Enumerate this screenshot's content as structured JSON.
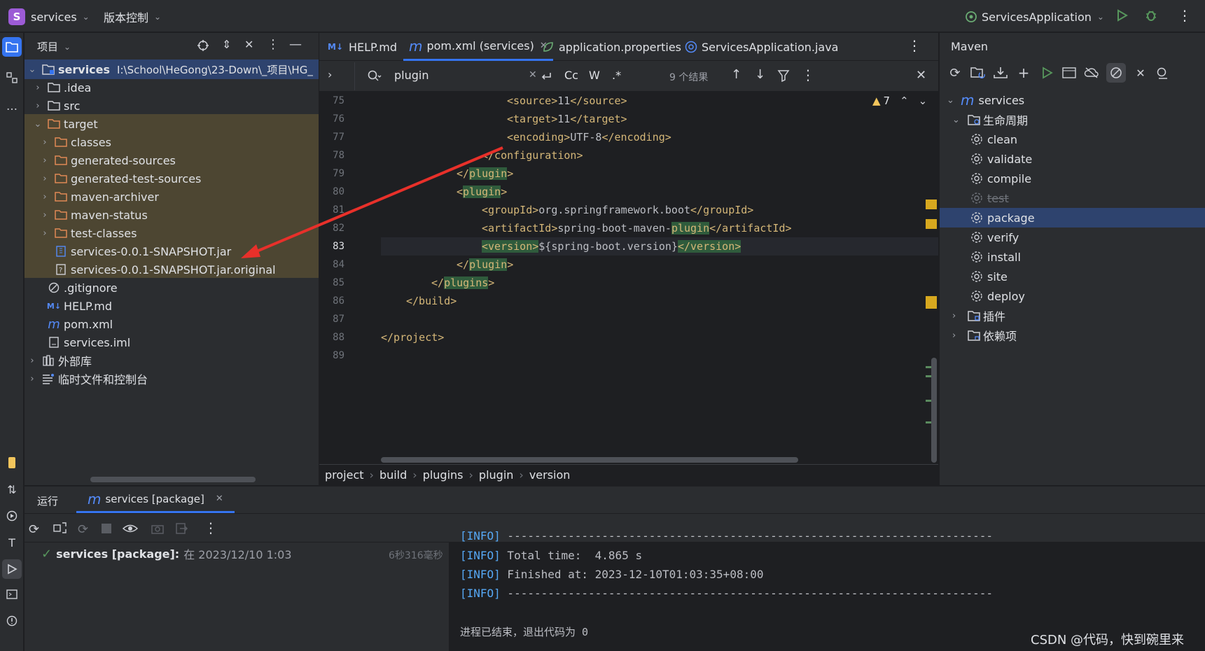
{
  "titlebar": {
    "project_badge": "S",
    "project_name": "services",
    "vcs": "版本控制",
    "run_config": "ServicesApplication"
  },
  "project_panel": {
    "title": "项目",
    "root": {
      "name": "services",
      "path": "I:\\School\\HeGong\\23-Down\\_项目\\HG_"
    },
    "items": [
      ".idea",
      "src",
      "target",
      "classes",
      "generated-sources",
      "generated-test-sources",
      "maven-archiver",
      "maven-status",
      "test-classes",
      "services-0.0.1-SNAPSHOT.jar",
      "services-0.0.1-SNAPSHOT.jar.original",
      ".gitignore",
      "HELP.md",
      "pom.xml",
      "services.iml",
      "外部库",
      "临时文件和控制台"
    ]
  },
  "editor": {
    "tabs": [
      "HELP.md",
      "pom.xml (services)",
      "application.properties",
      "ServicesApplication.java"
    ],
    "find": {
      "query": "plugin",
      "results": "9 个结果",
      "opt_cc": "Cc",
      "opt_w": "W",
      "opt_regex": ".*"
    },
    "warnings": "7",
    "line_numbers": [
      "75",
      "76",
      "77",
      "78",
      "79",
      "80",
      "81",
      "82",
      "83",
      "84",
      "85",
      "86",
      "87",
      "88",
      "89"
    ],
    "code": {
      "l75": {
        "open": "<source>",
        "val": "11",
        "close": "</source>"
      },
      "l76": {
        "open": "<target>",
        "val": "11",
        "close": "</target>"
      },
      "l77": {
        "open": "<encoding>",
        "val": "UTF-8",
        "close": "</encoding>"
      },
      "l78": {
        "close": "</configuration>"
      },
      "l79": {
        "pre": "</",
        "word": "plugin",
        "post": ">"
      },
      "l80": {
        "pre": "<",
        "word": "plugin",
        "post": ">"
      },
      "l81": {
        "open": "<groupId>",
        "val": "org.springframework.boot",
        "close": "</groupId>"
      },
      "l82": {
        "open": "<artifactId>",
        "val": "spring-boot-maven-",
        "word": "plugin",
        "close": "</artifactId>"
      },
      "l83": {
        "open": "<version>",
        "val": "${spring-boot.version}",
        "close": "</version>"
      },
      "l84": {
        "pre": "</",
        "word": "plugin",
        "post": ">"
      },
      "l85": {
        "pre": "</",
        "word": "plugins",
        "post": ">"
      },
      "l86": {
        "close": "</build>"
      },
      "l88": {
        "close": "</project>"
      }
    },
    "breadcrumbs": [
      "project",
      "build",
      "plugins",
      "plugin",
      "version"
    ]
  },
  "maven": {
    "title": "Maven",
    "root": "services",
    "lifecycle": "生命周期",
    "goals": [
      "clean",
      "validate",
      "compile",
      "test",
      "package",
      "verify",
      "install",
      "site",
      "deploy"
    ],
    "plugins": "插件",
    "deps": "依赖项"
  },
  "run": {
    "tab_label": "运行",
    "run_tab": "services [package]",
    "task_name": "services [package]:",
    "task_time": "在 2023/12/10 1:03",
    "duration": "6秒316毫秒",
    "console": {
      "info": "[INFO]",
      "dashes": " ------------------------------------------------------------------------",
      "total": " Total time:  4.865 s",
      "finished": " Finished at: 2023-12-10T01:03:35+08:00",
      "exit": "进程已结束，退出代码为 0"
    }
  },
  "watermark": "CSDN @代码，快到碗里来",
  "colors": {
    "accent": "#3574f0",
    "selection": "#2e436e",
    "tag": "#d5b778",
    "arrow": "#e8302a"
  }
}
